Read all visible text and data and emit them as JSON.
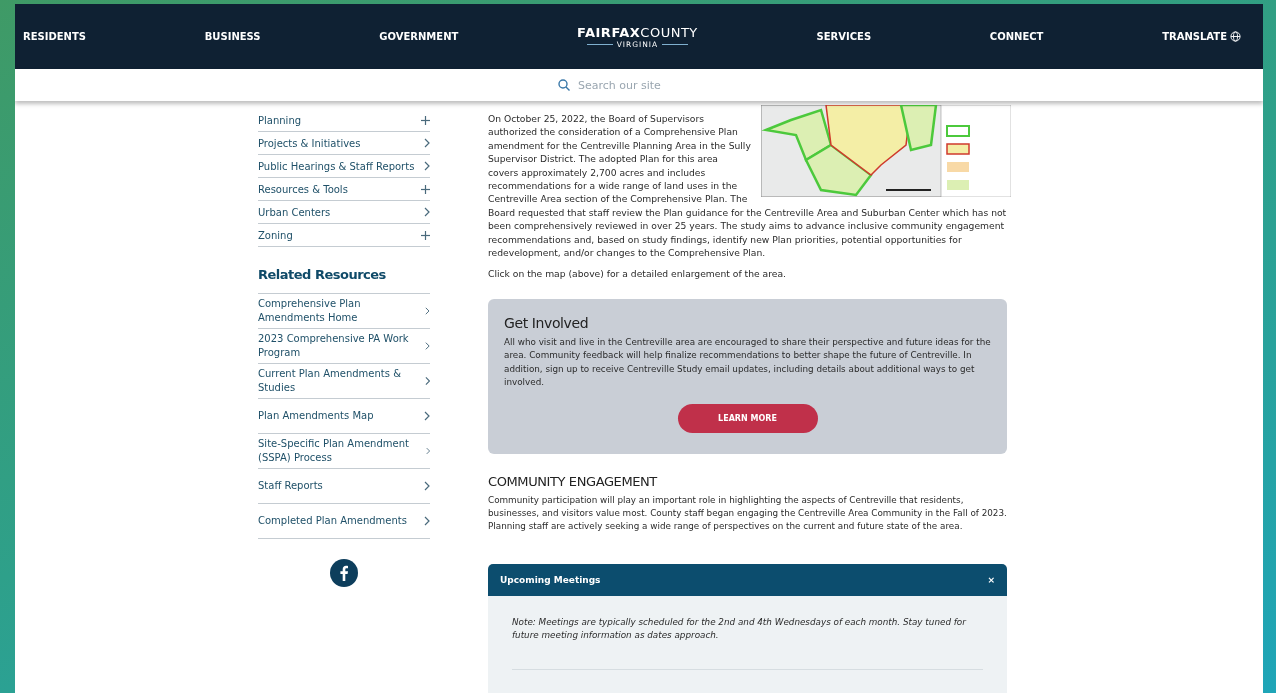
{
  "nav": {
    "items": [
      "RESIDENTS",
      "BUSINESS",
      "GOVERNMENT"
    ],
    "items_right": [
      "SERVICES",
      "CONNECT",
      "TRANSLATE"
    ],
    "logo": {
      "bold": "FAIRFAX",
      "light": "COUNTY",
      "sub": "VIRGINIA"
    }
  },
  "search": {
    "placeholder": "Search our site"
  },
  "sidebar": {
    "items": [
      {
        "label": "Planning",
        "kind": "plus"
      },
      {
        "label": "Projects & Initiatives",
        "kind": "chevron"
      },
      {
        "label": "Public Hearings & Staff Reports",
        "kind": "chevron"
      },
      {
        "label": "Resources & Tools",
        "kind": "plus"
      },
      {
        "label": "Urban Centers",
        "kind": "chevron"
      },
      {
        "label": "Zoning",
        "kind": "plus"
      }
    ],
    "related_title": "Related Resources",
    "related": [
      {
        "label": "Comprehensive Plan Amendments Home",
        "kind": "chevron"
      },
      {
        "label": "2023 Comprehensive PA Work Program",
        "kind": "chevron"
      },
      {
        "label": "Current Plan Amendments & Studies",
        "kind": "chevron"
      },
      {
        "label": "Plan Amendments Map",
        "kind": "chevron"
      },
      {
        "label": "Site-Specific Plan Amendment (SSPA) Process",
        "kind": "chevron"
      },
      {
        "label": "Staff Reports",
        "kind": "chevron"
      },
      {
        "label": "Completed Plan Amendments",
        "kind": "chevron"
      }
    ]
  },
  "main": {
    "intro_beside_map": "On October 25, 2022, the Board of Supervisors authorized the consideration of a Comprehensive Plan amendment for the Centreville Planning Area in the Sully Supervisor District. The adopted Plan for this area covers approximately 2,700 acres and includes recommendations for a wide range of land uses in the Centreville Area section of the Comprehensive Plan. The",
    "intro": "Board requested that staff review the Plan guidance for the Centreville Area and Suburban Center which has not been comprehensively reviewed in over 25 years. The study aims to advance inclusive community engagement recommendations and, based on study findings, identify new Plan priorities, potential opportunities for redevelopment, and/or changes to the Comprehensive Plan.",
    "map_note": "Click on the map (above) for a detailed enlargement of the area.",
    "callout": {
      "title": "Get Involved",
      "text": "All who visit and live in the Centreville area are encouraged to share their perspective and future ideas for the area. Community feedback will help finalize recommendations to better shape the future of Centreville. In addition, sign up to receive Centreville Study email updates, including details about additional ways to get involved.",
      "button": "LEARN MORE"
    },
    "engagement": {
      "title": "COMMUNITY ENGAGEMENT",
      "text": "Community participation will play an important role in highlighting the aspects of Centreville that residents, businesses, and visitors value most. County staff began engaging the Centreville Area Community in the Fall of 2023. Planning staff are actively seeking a wide range of perspectives on the current and future state of the area."
    },
    "meetings": {
      "title": "Upcoming Meetings",
      "close": "×",
      "expanded": true,
      "note": "Note: Meetings are typically scheduled for the 2nd and 4th Wednesdays of each month. Stay tuned for future meeting information as dates approach."
    }
  }
}
